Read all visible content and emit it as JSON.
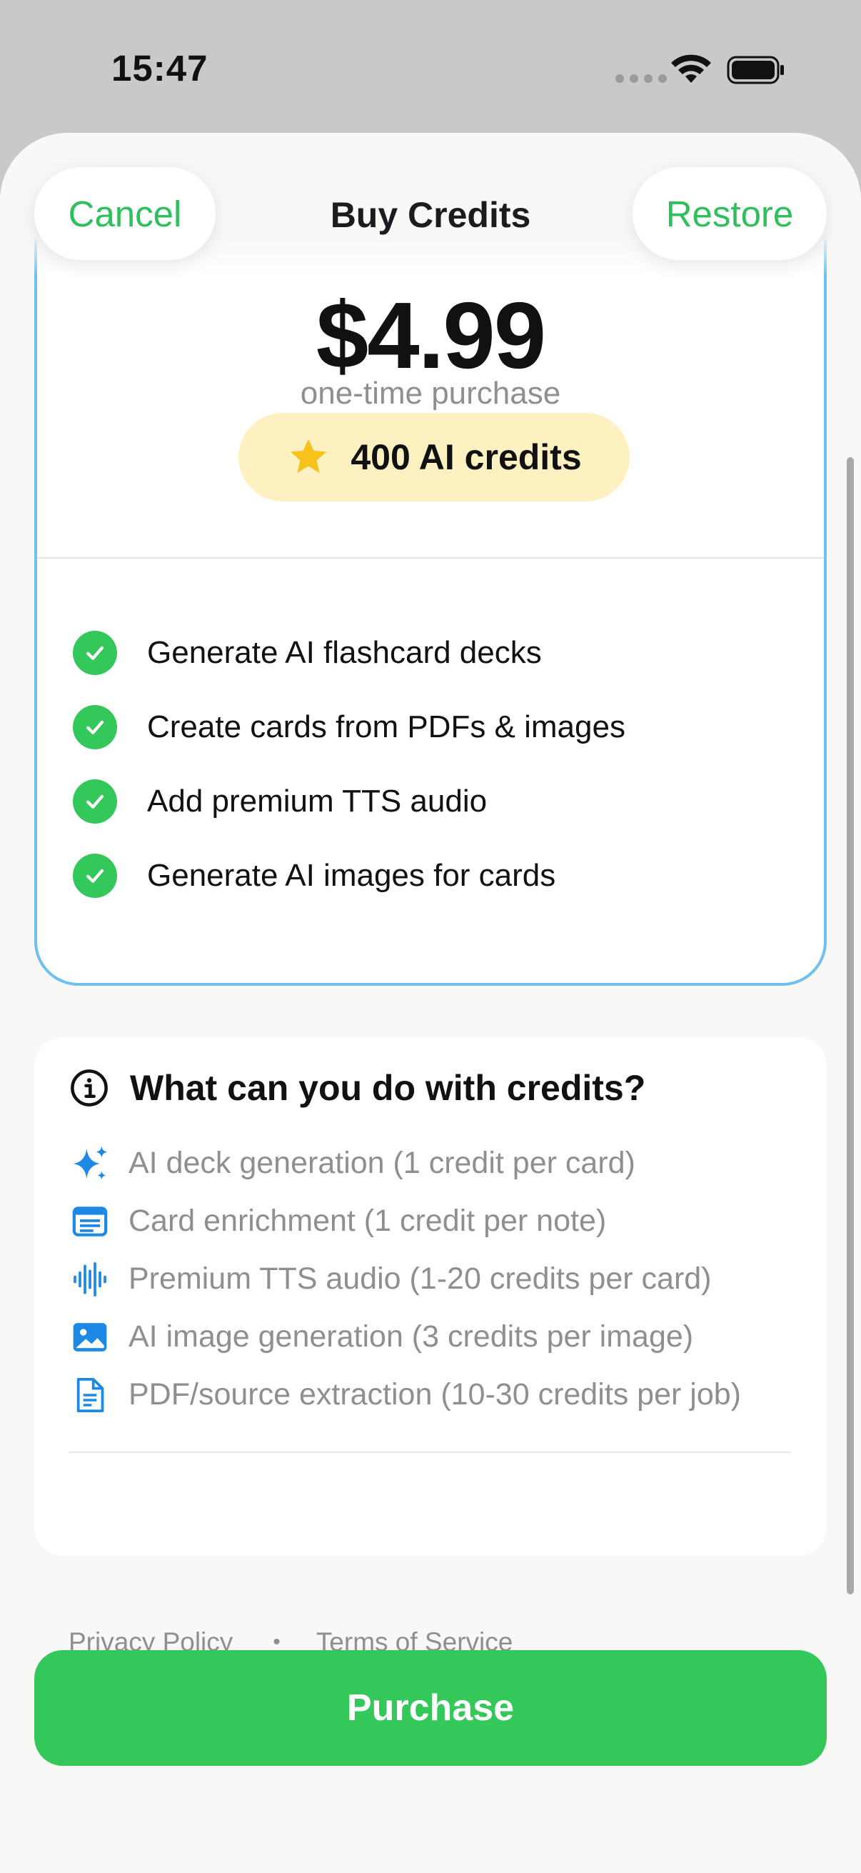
{
  "status_bar": {
    "time": "15:47"
  },
  "nav": {
    "cancel_label": "Cancel",
    "title": "Buy Credits",
    "restore_label": "Restore"
  },
  "plan": {
    "price": "$4.99",
    "price_note": "one-time purchase",
    "credits_badge": "400 AI credits",
    "features": [
      "Generate AI flashcard decks",
      "Create cards from PDFs & images",
      "Add premium TTS audio",
      "Generate AI images for cards"
    ]
  },
  "info": {
    "title": "What can you do with credits?",
    "uses": [
      {
        "icon": "sparkles-icon",
        "label": "AI deck generation (1 credit per card)"
      },
      {
        "icon": "note-icon",
        "label": "Card enrichment (1 credit per note)"
      },
      {
        "icon": "waveform-icon",
        "label": "Premium TTS audio (1-20 credits per card)"
      },
      {
        "icon": "photo-icon",
        "label": "AI image generation (3 credits per image)"
      },
      {
        "icon": "document-icon",
        "label": "PDF/source extraction (10-30 credits per job)"
      }
    ],
    "privacy_label": "Privacy Policy",
    "separator": "•",
    "terms_label": "Terms of Service"
  },
  "purchase_label": "Purchase",
  "colors": {
    "accent_green": "#34c759",
    "card_border": "#6ec1ee",
    "badge_bg": "#fdf1c2",
    "icon_blue": "#1e88e5"
  }
}
